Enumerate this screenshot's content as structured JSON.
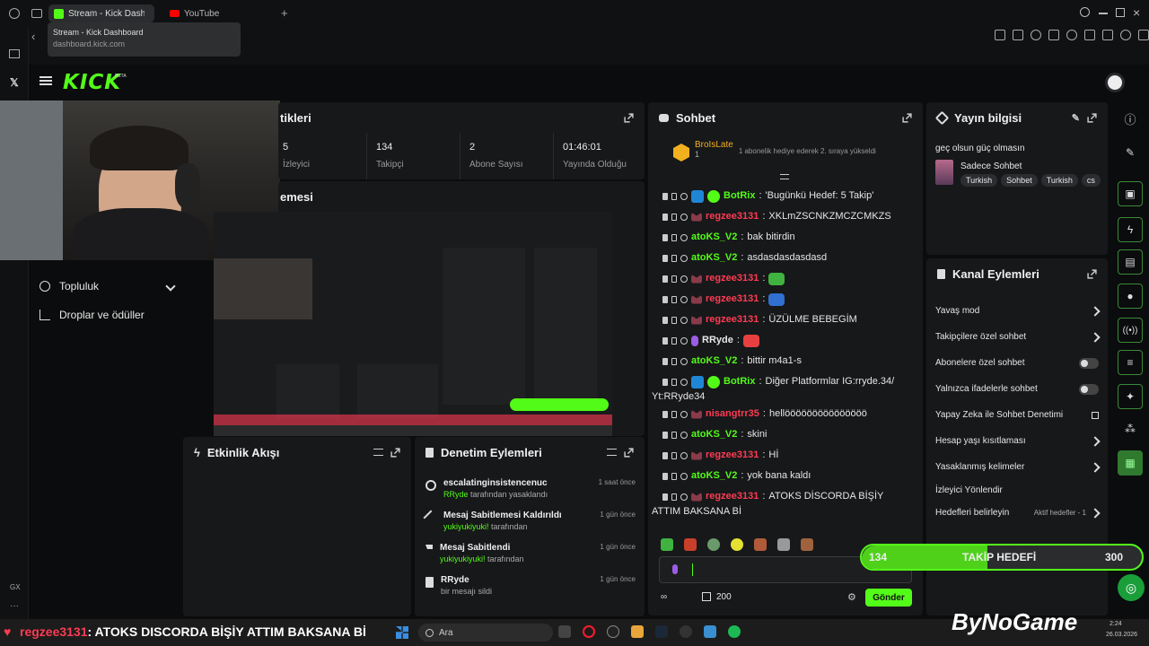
{
  "browser": {
    "tabs": [
      {
        "label": "Stream - Kick Dashboard"
      },
      {
        "label": "YouTube"
      }
    ],
    "tooltip": {
      "title": "Stream - Kick Dashboard",
      "url": "dashboard.kick.com"
    }
  },
  "header": {
    "logo": "KICK",
    "logo_sup": "BETA"
  },
  "stats": {
    "title": "tikleri",
    "items": [
      {
        "value": "5",
        "label": "İzleyici"
      },
      {
        "value": "134",
        "label": "Takipçi"
      },
      {
        "value": "2",
        "label": "Abone Sayısı"
      },
      {
        "value": "01:46:01",
        "label": "Yayında Olduğu"
      }
    ]
  },
  "preview": {
    "title": "emesi"
  },
  "left_menu": {
    "items": [
      {
        "label": "Topluluk"
      },
      {
        "label": "Droplar ve ödüller"
      }
    ]
  },
  "activity": {
    "title": "Etkinlik Akışı"
  },
  "moderation": {
    "title": "Denetim Eylemleri",
    "items": [
      {
        "title": "escalatinginsistencenuc",
        "sub_user": "RRyde",
        "sub_text": " tarafından yasaklandı",
        "time": "1 saat önce"
      },
      {
        "title": "Mesaj Sabitlemesi Kaldırıldı",
        "sub_user": "yukiyukiyuki!",
        "sub_text": " tarafından",
        "time": "1 gün önce"
      },
      {
        "title": "Mesaj Sabitlendi",
        "sub_user": "yukiyukiyuki!",
        "sub_text": " tarafından",
        "time": "1 gün önce"
      },
      {
        "title": "RRyde",
        "sub_user": "",
        "sub_text": "bir mesajı sildi",
        "time": "1 gün önce"
      }
    ]
  },
  "chat": {
    "title": "Sohbet",
    "pinned": {
      "user": "BroIsLate",
      "count": "1",
      "text": "1 abonelik hediye ederek 2. sıraya yükseldi"
    },
    "messages": [
      {
        "user": "BotRix",
        "color": "#53fc18",
        "bot": true,
        "text": "'Bugünkü Hedef: 5 Takip'"
      },
      {
        "user": "regzee3131",
        "color": "#ff3b53",
        "text": "XKLmZSCNKZMCZCMKZS"
      },
      {
        "user": "atoKS_V2",
        "color": "#53fc18",
        "text": "bak bitirdin"
      },
      {
        "user": "atoKS_V2",
        "color": "#53fc18",
        "text": "asdasdasdasdasd"
      },
      {
        "user": "regzee3131",
        "color": "#ff3b53",
        "text": "",
        "emote": "#3fb23f"
      },
      {
        "user": "regzee3131",
        "color": "#ff3b53",
        "text": "",
        "emote": "#3070d0"
      },
      {
        "user": "regzee3131",
        "color": "#ff3b53",
        "text": "ÜZÜLME BEBEGİM"
      },
      {
        "user": "RRyde",
        "color": "#e8e8e8",
        "text": "",
        "emote": "#e84040"
      },
      {
        "user": "atoKS_V2",
        "color": "#53fc18",
        "text": "bittir m4a1-s"
      },
      {
        "user": "BotRix",
        "color": "#53fc18",
        "bot": true,
        "text": "Diğer Platformlar IG:rryde.34/",
        "text2": "Yt:RRyde34"
      },
      {
        "user": "nisangtrr35",
        "color": "#ff3b53",
        "text": "hellööööööööööööööö"
      },
      {
        "user": "atoKS_V2",
        "color": "#53fc18",
        "text": "skini"
      },
      {
        "user": "regzee3131",
        "color": "#ff3b53",
        "text": "Hİ"
      },
      {
        "user": "atoKS_V2",
        "color": "#53fc18",
        "text": "yok bana kaldı"
      },
      {
        "user": "regzee3131",
        "color": "#ff3b53",
        "text": "ATOKS DİSCORDA BİŞİY",
        "text2": "ATTIM BAKSANA Bİ"
      }
    ],
    "points": "200",
    "send_label": "Gönder"
  },
  "stream_info": {
    "title": "Yayın bilgisi",
    "stream_title": "geç olsun güç olmasın",
    "category": "Sadece Sohbet",
    "tags": [
      "Turkish",
      "Sohbet",
      "Turkish",
      "cs"
    ]
  },
  "channel_actions": {
    "title": "Kanal Eylemleri",
    "items": [
      {
        "label": "Yavaş mod",
        "control": "chevron"
      },
      {
        "label": "Takipçilere özel sohbet",
        "control": "chevron"
      },
      {
        "label": "Abonelere özel sohbet",
        "control": "toggle"
      },
      {
        "label": "Yalnızca ifadelerle sohbet",
        "control": "toggle"
      },
      {
        "label": "Yapay Zeka ile Sohbet Denetimi",
        "control": "external"
      },
      {
        "label": "Hesap yaşı kısıtlaması",
        "control": "chevron"
      },
      {
        "label": "Yasaklanmış kelimeler",
        "control": "chevron"
      },
      {
        "label": "İzleyici Yönlendir",
        "control": "none"
      },
      {
        "label": "Hedefleri belirleyin",
        "control": "chevron",
        "extra": "Aktif hedefler - 1"
      }
    ]
  },
  "follow_goal": {
    "current": "134",
    "label": "TAKİP HEDEFİ",
    "target": "300",
    "progress": 0.45
  },
  "overlay": {
    "ticker_user": "regzee3131",
    "ticker_text": ": ATOKS DISCORDA BİŞİY ATTIM BAKSANA Bİ",
    "brand": "ByNoGame"
  },
  "taskbar": {
    "search": "Ara",
    "time": "2:24",
    "date": "26.03.2026"
  },
  "colors": {
    "kick_green": "#53fc18",
    "panel": "#17181a",
    "red_user": "#ff3b53"
  }
}
